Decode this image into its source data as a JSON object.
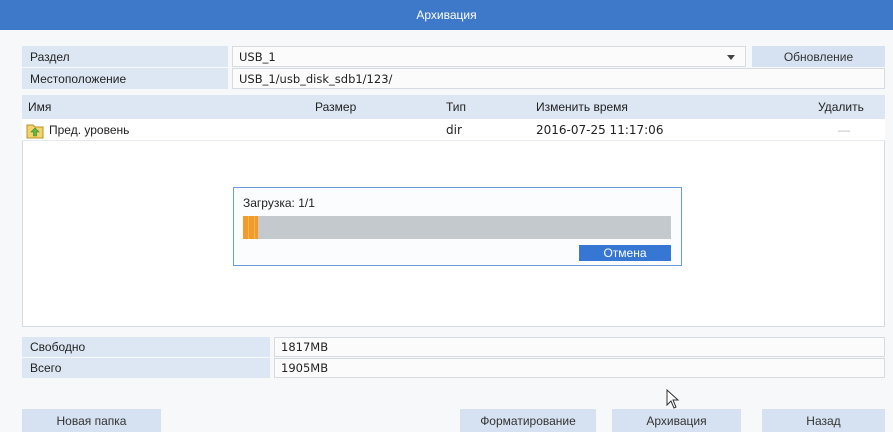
{
  "title": "Архивация",
  "partition": {
    "label": "Раздел",
    "value": "USB_1"
  },
  "location": {
    "label": "Местоположение",
    "value": "USB_1/usb_disk_sdb1/123/"
  },
  "refresh_label": "Обновление",
  "table": {
    "headers": {
      "name": "Имя",
      "size": "Размер",
      "type": "Тип",
      "modified": "Изменить время",
      "delete": "Удалить"
    },
    "rows": [
      {
        "name": "Пред. уровень",
        "size": "",
        "type": "dir",
        "modified": "2016-07-25 11:17:06",
        "delete": "—",
        "icon": "folder-up-icon"
      }
    ]
  },
  "progress_dialog": {
    "text": "Загрузка: 1/1",
    "progress": 0.035,
    "cancel_label": "Отмена"
  },
  "free": {
    "label": "Свободно",
    "value": "1817MB"
  },
  "total": {
    "label": "Всего",
    "value": "1905MB"
  },
  "buttons": {
    "new_folder": "Новая папка",
    "format": "Форматирование",
    "backup": "Архивация",
    "back": "Назад"
  },
  "colors": {
    "titlebar": "#3e78c8",
    "accent": "#3677d3",
    "progress": "#f39a2a"
  }
}
